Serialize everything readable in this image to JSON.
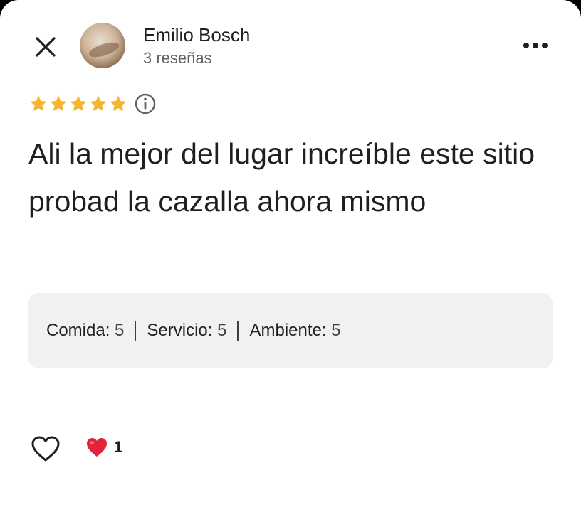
{
  "user": {
    "name": "Emilio Bosch",
    "reviews_label": "3 reseñas"
  },
  "review": {
    "rating": 5,
    "max_rating": 5,
    "text": "Ali la mejor del lugar increíble este sitio probad la cazalla ahora mismo"
  },
  "ratings": [
    {
      "label": "Comida:",
      "value": "5"
    },
    {
      "label": "Servicio:",
      "value": "5"
    },
    {
      "label": "Ambiente:",
      "value": "5"
    }
  ],
  "reactions": {
    "heart_count": "1"
  },
  "icons": {
    "close": "close-icon",
    "more": "more-horizontal-icon",
    "star": "star-icon",
    "info": "info-icon",
    "like": "heart-outline-icon",
    "reaction": "red-heart-icon"
  },
  "colors": {
    "star": "#f5b52e",
    "heart": "#e0243a",
    "ratings_box": "#f1f1f1",
    "secondary_text": "#5f6368"
  }
}
